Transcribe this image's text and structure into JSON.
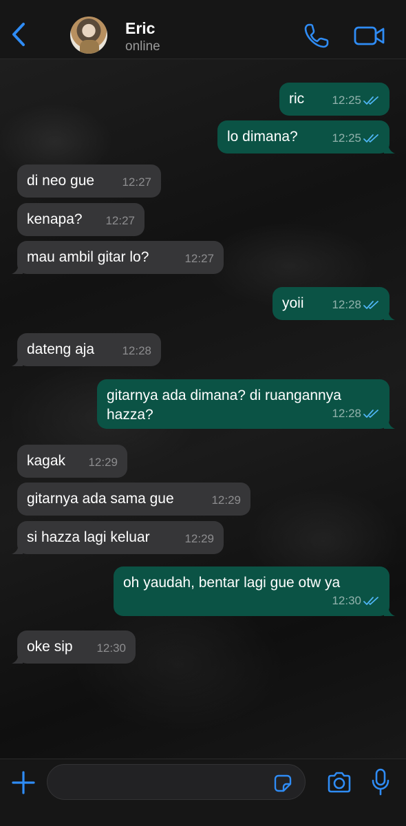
{
  "header": {
    "contact_name": "Eric",
    "contact_status": "online",
    "back_icon": "chevron-left-icon",
    "call_icon": "phone-icon",
    "video_icon": "video-camera-icon"
  },
  "colors": {
    "accent": "#2f8cf5",
    "bubble_in": "#363638",
    "bubble_out": "#0b5345",
    "read_ticks": "#4fb6f5"
  },
  "messages": [
    {
      "dir": "out",
      "text": "ric",
      "time": "12:25",
      "read": true
    },
    {
      "dir": "out",
      "text": "lo dimana?",
      "time": "12:25",
      "read": true
    },
    {
      "dir": "in",
      "text": "di neo gue",
      "time": "12:27"
    },
    {
      "dir": "in",
      "text": "kenapa?",
      "time": "12:27"
    },
    {
      "dir": "in",
      "text": "mau ambil gitar lo?",
      "time": "12:27"
    },
    {
      "dir": "out",
      "text": "yoii",
      "time": "12:28",
      "read": true
    },
    {
      "dir": "in",
      "text": "dateng aja",
      "time": "12:28"
    },
    {
      "dir": "out",
      "text": "gitarnya ada dimana? di ruangannya\nhazza?",
      "time": "12:28",
      "read": true
    },
    {
      "dir": "in",
      "text": "kagak",
      "time": "12:29"
    },
    {
      "dir": "in",
      "text": "gitarnya ada sama gue",
      "time": "12:29"
    },
    {
      "dir": "in",
      "text": "si hazza lagi keluar",
      "time": "12:29"
    },
    {
      "dir": "out",
      "text": "oh yaudah, bentar lagi gue otw ya",
      "time": "12:30",
      "read": true
    },
    {
      "dir": "in",
      "text": "oke sip",
      "time": "12:30"
    }
  ],
  "composer": {
    "input_value": "",
    "plus_icon": "plus-icon",
    "sticker_icon": "sticker-icon",
    "camera_icon": "camera-icon",
    "mic_icon": "microphone-icon"
  }
}
